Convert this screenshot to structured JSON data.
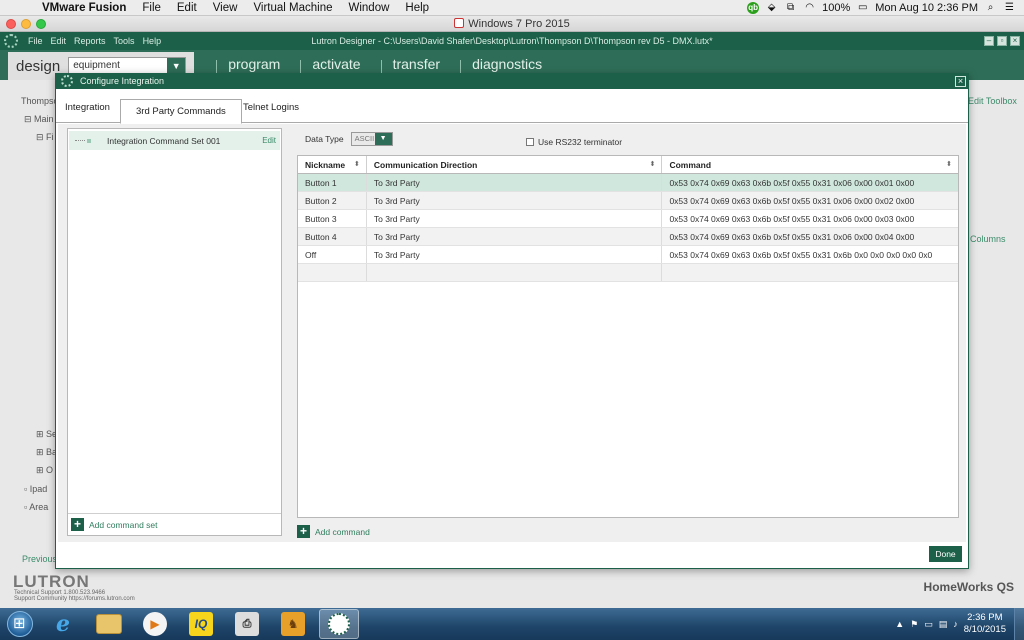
{
  "mac": {
    "app_name": "VMware Fusion",
    "menus": [
      "File",
      "Edit",
      "View",
      "Virtual Machine",
      "Window",
      "Help"
    ],
    "battery": "100%",
    "datetime": "Mon Aug 10  2:36 PM"
  },
  "vm_window": {
    "title": "Windows 7 Pro 2015"
  },
  "app": {
    "menus": [
      "File",
      "Edit",
      "Reports",
      "Tools",
      "Help"
    ],
    "title_path": "Lutron Designer - C:\\Users\\David Shafer\\Desktop\\Lutron\\Thompson D\\Thompson rev D5 - DMX.lutx*",
    "design_tab": "design",
    "equipment_select": "equipment",
    "tabs": [
      "program",
      "activate",
      "transfer",
      "diagnostics"
    ],
    "left_fragments": [
      "Thompson",
      "Main",
      "Fi",
      "Se",
      "Ba",
      "O",
      "Ipad",
      "Area"
    ],
    "edit_toolbox": "Edit Toolbox",
    "columns_text": "Columns",
    "previous": "Previous",
    "logo": "LUTRON",
    "support_line1": "Technical Support 1.800.523.9466",
    "support_line2": "Support Community https://forums.lutron.com",
    "product": "HomeWorks QS"
  },
  "dialog": {
    "title": "Configure Integration",
    "tabs": [
      "Integration",
      "3rd Party Commands",
      "Telnet Logins"
    ],
    "active_tab": "3rd Party Commands",
    "command_set": {
      "name": "Integration Command Set 001",
      "edit": "Edit"
    },
    "add_command_set": "Add command set",
    "data_type_label": "Data Type",
    "data_type_value": "ASCII",
    "rs232_label": "Use RS232 terminator",
    "rs232_checked": false,
    "columns": [
      "Nickname",
      "Communication Direction",
      "Command"
    ],
    "rows": [
      {
        "nickname": "Button 1",
        "direction": "To 3rd Party",
        "command": "0x53 0x74 0x69 0x63 0x6b 0x5f 0x55 0x31 0x06 0x00 0x01 0x00",
        "selected": true
      },
      {
        "nickname": "Button 2",
        "direction": "To 3rd Party",
        "command": "0x53 0x74 0x69 0x63 0x6b 0x5f 0x55 0x31 0x06 0x00 0x02 0x00",
        "selected": false
      },
      {
        "nickname": "Button 3",
        "direction": "To 3rd Party",
        "command": "0x53 0x74 0x69 0x63 0x6b 0x5f 0x55 0x31 0x06 0x00 0x03 0x00",
        "selected": false
      },
      {
        "nickname": "Button 4",
        "direction": "To 3rd Party",
        "command": "0x53 0x74 0x69 0x63 0x6b 0x5f 0x55 0x31 0x06 0x00 0x04 0x00",
        "selected": false
      },
      {
        "nickname": "Off",
        "direction": "To 3rd Party",
        "command": "0x53 0x74 0x69 0x63 0x6b 0x5f 0x55 0x31 0x6b 0x0 0x0 0x0 0x0 0x0",
        "selected": false
      },
      {
        "nickname": "",
        "direction": "",
        "command": "",
        "selected": false
      }
    ],
    "add_command": "Add command",
    "done": "Done"
  },
  "taskbar": {
    "apps": [
      "internet-explorer-icon",
      "folder-icon",
      "media-player-icon",
      "iq-icon",
      "printer-icon",
      "horse-icon",
      "lutron-designer-icon"
    ],
    "time": "2:36 PM",
    "date": "8/10/2015"
  },
  "colors": {
    "lutron_green": "#1d6049",
    "tab_green": "#2e6e58",
    "selected_row": "#d0e7dd"
  }
}
